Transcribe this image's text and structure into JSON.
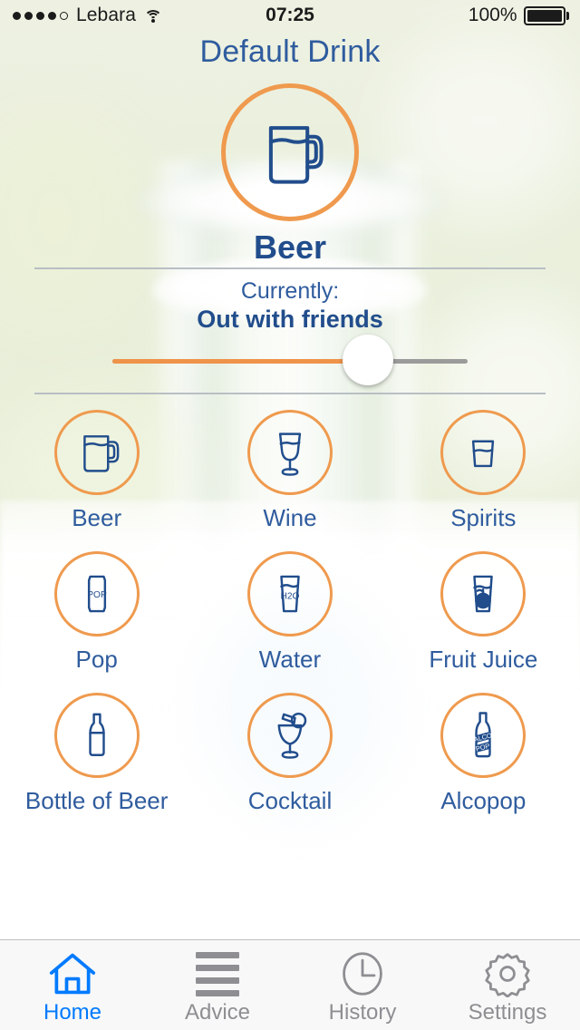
{
  "status_bar": {
    "signal_dots_filled": 4,
    "signal_dots_total": 5,
    "carrier": "Lebara",
    "wifi_icon": "wifi-icon",
    "time": "07:25",
    "battery_percent": "100%",
    "battery_level": 100
  },
  "header": {
    "title": "Default Drink"
  },
  "hero": {
    "icon": "beer-mug-icon",
    "name": "Beer"
  },
  "currently": {
    "label": "Currently:",
    "value": "Out with friends"
  },
  "slider": {
    "name": "drink-amount-slider",
    "value_percent": 72,
    "min": 0,
    "max": 100
  },
  "drinks": [
    {
      "label": "Beer",
      "icon": "beer-mug-icon"
    },
    {
      "label": "Wine",
      "icon": "wine-glass-icon"
    },
    {
      "label": "Spirits",
      "icon": "tumbler-glass-icon"
    },
    {
      "label": "Pop",
      "icon": "soda-can-icon",
      "icon_text": "POP"
    },
    {
      "label": "Water",
      "icon": "water-glass-icon",
      "icon_text": "H2O"
    },
    {
      "label": "Fruit Juice",
      "icon": "juice-glass-icon"
    },
    {
      "label": "Bottle of Beer",
      "icon": "beer-bottle-icon"
    },
    {
      "label": "Cocktail",
      "icon": "cocktail-glass-icon"
    },
    {
      "label": "Alcopop",
      "icon": "alcopop-bottle-icon",
      "icon_text": "ALCO POP"
    }
  ],
  "tabs": [
    {
      "label": "Home",
      "icon": "home-icon",
      "active": true
    },
    {
      "label": "Advice",
      "icon": "list-icon",
      "active": false
    },
    {
      "label": "History",
      "icon": "clock-icon",
      "active": false
    },
    {
      "label": "Settings",
      "icon": "gear-icon",
      "active": false
    }
  ],
  "colors": {
    "accent_orange": "#ef9a4e",
    "navy": "#214d8c",
    "title_blue": "#2f5c9e",
    "active_tab_blue": "#007aff",
    "inactive_tab_gray": "#8e8e93",
    "slider_track_gray": "#9b9b9b"
  }
}
